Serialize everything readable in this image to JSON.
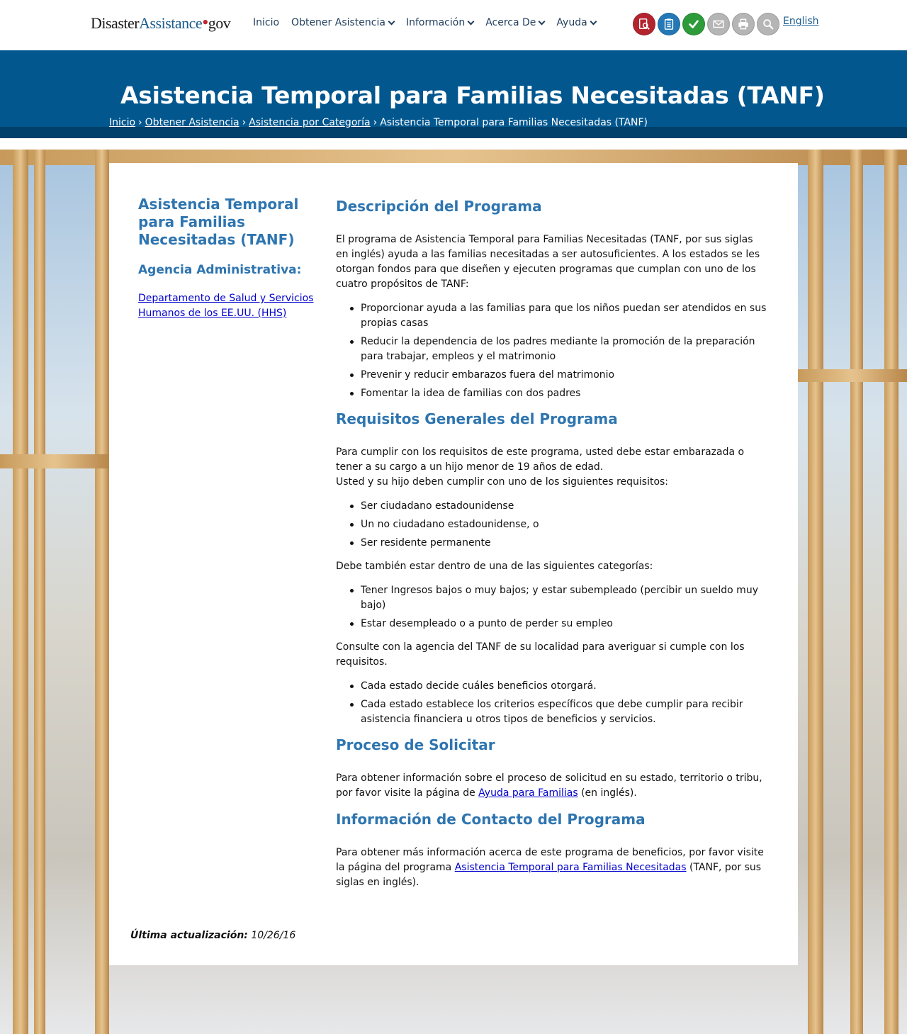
{
  "nav": {
    "logo_part1": "Disaster",
    "logo_part2": "Assistance",
    "logo_dot": "•",
    "logo_part3": "gov",
    "menu": [
      "Inicio",
      "Obtener Asistencia",
      "Información",
      "Acerca De",
      "Ayuda"
    ],
    "tool_icons": [
      {
        "name": "apply-online-icon",
        "color": "#b3242e"
      },
      {
        "name": "checklist-icon",
        "color": "#2378b5"
      },
      {
        "name": "check-status-icon",
        "color": "#2e9b3a"
      },
      {
        "name": "email-icon",
        "color": "#b5b5b5"
      },
      {
        "name": "print-icon",
        "color": "#b5b5b5"
      },
      {
        "name": "search-icon",
        "color": "#b5b5b5"
      }
    ],
    "language_link": "English"
  },
  "header": {
    "title": "Asistencia Temporal para Familias Necesitadas (TANF)",
    "breadcrumbs": [
      "Inicio",
      "Obtener Asistencia",
      "Asistencia por Categoría"
    ],
    "breadcrumb_separator": "›",
    "breadcrumb_current": "Asistencia Temporal para Familias Necesitadas (TANF)"
  },
  "sidebar": {
    "title": "Asistencia Temporal para Familias Necesitadas (TANF)",
    "agency_heading": "Agencia Administrativa:",
    "agency_link": "Departamento de Salud y Servicios Humanos de los EE.UU. (HHS)"
  },
  "main": {
    "description": {
      "heading": "Descripción del Programa",
      "paragraph": "El programa de Asistencia Temporal para Familias Necesitadas (TANF, por sus siglas en inglés) ayuda a las familias necesitadas a ser autosuficientes. A los estados se les otorgan fondos para que diseñen y ejecuten programas que cumplan con uno de los cuatro propósitos de TANF:",
      "bullets": [
        "Proporcionar ayuda a las familias para que los niños puedan ser atendidos en sus propias casas",
        "Reducir la dependencia de los padres mediante la promoción de la preparación para trabajar, empleos y el matrimonio",
        "Prevenir y reducir embarazos fuera del matrimonio",
        "Fomentar la idea de familias con dos padres"
      ]
    },
    "requirements": {
      "heading": "Requisitos Generales del Programa",
      "paragraph1_line1": "Para cumplir con los requisitos de este programa, usted debe estar embarazada o tener a su cargo a un hijo menor de 19 años de edad.",
      "paragraph1_line2": "Usted y su hijo deben cumplir con uno de los siguientes requisitos:",
      "bullets1": [
        "Ser ciudadano estadounidense",
        "Un no ciudadano estadounidense, o",
        "Ser residente permanente"
      ],
      "paragraph2": "Debe también estar dentro de una de las siguientes categorías:",
      "bullets2": [
        "Tener Ingresos bajos o muy bajos; y estar subempleado (percibir un sueldo muy bajo)",
        "Estar desempleado o a punto de perder su empleo"
      ],
      "paragraph3": "Consulte con la agencia del TANF de su localidad para averiguar si cumple con los requisitos.",
      "bullets3": [
        "Cada estado decide cuáles beneficios otorgará.",
        "Cada estado establece los criterios específicos que debe cumplir para recibir asistencia financiera u otros tipos de beneficios y servicios."
      ]
    },
    "process": {
      "heading": "Proceso de Solicitar",
      "text_before": "Para obtener información sobre el proceso de solicitud en su estado, territorio o tribu, por favor visite la página de ",
      "link": "Ayuda para Familias",
      "text_after": " (en inglés)."
    },
    "contact": {
      "heading": "Información de Contacto del Programa",
      "text_before": "Para obtener más información acerca de este programa de beneficios, por favor visite la página del programa ",
      "link": "Asistencia Temporal para Familias Necesitadas",
      "text_after": " (TANF, por sus siglas en inglés)."
    }
  },
  "footer": {
    "updated_label": "Última actualización:",
    "updated_date": "10/26/16"
  }
}
